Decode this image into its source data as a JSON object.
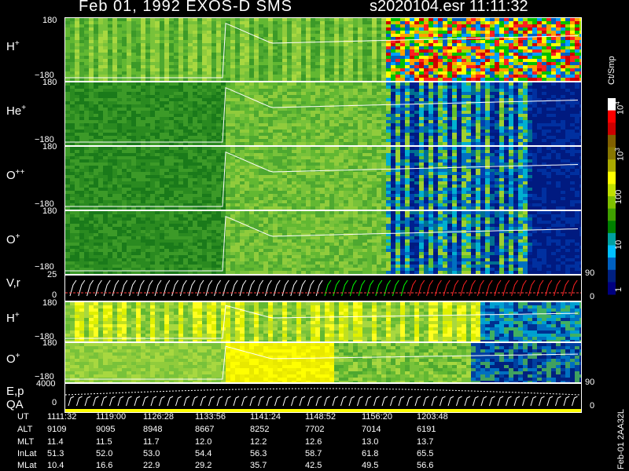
{
  "header": {
    "title": "Feb 01, 1992   EXOS-D SMS",
    "file_time": "s2020104.esr   11:11:32"
  },
  "panels": [
    {
      "label_main": "H",
      "label_sup": "+",
      "ytop": "180",
      "ybot": "−180"
    },
    {
      "label_main": "He",
      "label_sup": "+",
      "ytop": "180",
      "ybot": "−180"
    },
    {
      "label_main": "O",
      "label_sup": "++",
      "ytop": "180",
      "ybot": "−180"
    },
    {
      "label_main": "O",
      "label_sup": "+",
      "ytop": "180",
      "ybot": "−180"
    },
    {
      "label_main": "V,r",
      "label_sup": "",
      "ytop": "25",
      "ybot": "0"
    },
    {
      "label_main": "H",
      "label_sup": "+",
      "ytop": "180",
      "ybot": "−180"
    },
    {
      "label_main": "O",
      "label_sup": "+",
      "ytop": "180",
      "ybot": "−180"
    },
    {
      "label_main": "E,p",
      "label_sup": "",
      "label2": "QA",
      "ytop": "4000",
      "ybot": "0"
    }
  ],
  "right_axes": {
    "vr_top": "90",
    "vr_bot": "0",
    "ep_top": "90",
    "ep_bot": "0"
  },
  "colorbar": {
    "unit": "Ct/Smp",
    "ticks": [
      "10",
      "10",
      "100",
      "10",
      "1"
    ],
    "exps": [
      "4",
      "3",
      "",
      "",
      ""
    ],
    "colors": [
      "#ffffff",
      "#ff0000",
      "#cc0000",
      "#806000",
      "#887700",
      "#aaaa00",
      "#ffff00",
      "#c0e000",
      "#80c000",
      "#40a000",
      "#008000",
      "#00a0a0",
      "#00c0ff",
      "#0060c0",
      "#002080",
      "#000080"
    ]
  },
  "footer_side": "Feb-01 2AA32L",
  "chart_data": {
    "type": "heatmap",
    "x_labels": [
      "1111:32",
      "1119:00",
      "1126:28",
      "1133:56",
      "1141:24",
      "1148:52",
      "1156:20",
      "1203:48"
    ],
    "y_range": [
      -180,
      180
    ],
    "color_scale": "log",
    "color_range": [
      1,
      10000
    ],
    "color_unit": "Ct/Smp"
  },
  "table": {
    "rows": [
      {
        "name": "UT",
        "values": [
          "1111:32",
          "1119:00",
          "1126:28",
          "1133:56",
          "1141:24",
          "1148:52",
          "1156:20",
          "1203:48"
        ]
      },
      {
        "name": "ALT",
        "values": [
          "9109",
          "9095",
          "8948",
          "8667",
          "8252",
          "7702",
          "7014",
          "6191"
        ]
      },
      {
        "name": "MLT",
        "values": [
          "11.4",
          "11.5",
          "11.7",
          "12.0",
          "12.2",
          "12.6",
          "13.0",
          "13.7"
        ]
      },
      {
        "name": "InLat",
        "values": [
          "51.3",
          "52.0",
          "53.0",
          "54.4",
          "56.3",
          "58.7",
          "61.8",
          "65.5"
        ]
      },
      {
        "name": "MLat",
        "values": [
          "10.4",
          "16.6",
          "22.9",
          "29.2",
          "35.7",
          "42.5",
          "49.5",
          "56.6"
        ]
      }
    ]
  }
}
